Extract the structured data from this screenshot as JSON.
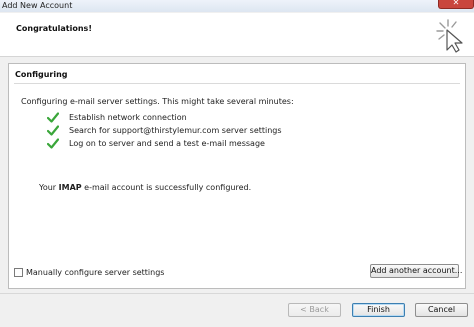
{
  "window": {
    "title": "Add New Account",
    "close_icon": "close-icon"
  },
  "header": {
    "heading": "Congratulations!",
    "graphic_icon": "sparkle-cursor-icon"
  },
  "configuring": {
    "section_title": "Configuring",
    "intro": "Configuring e-mail server settings. This might take several minutes:",
    "steps": [
      {
        "label": "Establish network connection",
        "status_icon": "checkmark-icon"
      },
      {
        "label": "Search for support@thirstylemur.com server settings",
        "status_icon": "checkmark-icon"
      },
      {
        "label": "Log on to server and send a test e-mail message",
        "status_icon": "checkmark-icon"
      }
    ],
    "success": {
      "prefix": "Your ",
      "account_type": "IMAP",
      "suffix": " e-mail account is successfully configured."
    },
    "manual_checkbox": {
      "label": "Manually configure server settings",
      "checked": false
    },
    "add_another_label": "Add another account..."
  },
  "footer": {
    "back_label": "< Back",
    "finish_label": "Finish",
    "cancel_label": "Cancel"
  },
  "colors": {
    "check_green": "#3aa63a",
    "header_bg": "#ffffff",
    "window_bg": "#f0f0f0"
  }
}
